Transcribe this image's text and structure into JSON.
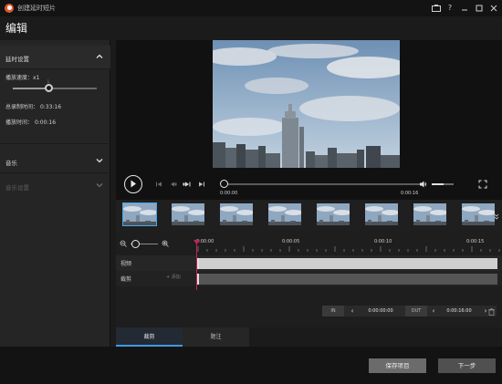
{
  "window": {
    "title": "创建延时短片",
    "controls": [
      "device-icon",
      "help-icon",
      "minimize-icon",
      "maximize-icon",
      "close-icon"
    ]
  },
  "header": {
    "title": "编辑"
  },
  "sidebar": {
    "section_timelapse": {
      "label": "延时设置",
      "expanded": true,
      "speed_label": "播放速度：",
      "speed_value": "x1",
      "speed_slider": {
        "level": 0.42,
        "tick_label": "1"
      },
      "total_record_label": "总录制时间：",
      "total_record_value": "0:33:16",
      "play_time_label": "播放时间：",
      "play_time_value": "0:00:16"
    },
    "section_music": {
      "label": "音乐",
      "expanded": false
    },
    "section_music_settings": {
      "label": "音乐设置",
      "expanded": false,
      "disabled": true
    }
  },
  "player": {
    "current_time": "0:00:00",
    "end_time": "0:00:16",
    "progress": 0,
    "volume": 0.55,
    "controls": [
      "play-icon",
      "skip-start-icon",
      "prev-frame-icon",
      "next-frame-icon",
      "skip-end-icon",
      "volume-icon",
      "fullscreen-icon"
    ]
  },
  "thumbnails": {
    "count": 8,
    "selected_index": 0
  },
  "timeline": {
    "ruler_labels": [
      "0:00:00",
      "0:00:05",
      "0:00:10",
      "0:00:15"
    ],
    "tracks": [
      {
        "label": "视频"
      },
      {
        "label": "裁剪",
        "add_label": "+ 添加"
      }
    ],
    "in_label": "IN",
    "in_value": "0:00:00:00",
    "out_label": "OUT",
    "out_value": "0:00:16:00"
  },
  "tabs": [
    {
      "label": "裁剪",
      "active": true
    },
    {
      "label": "题注",
      "active": false
    }
  ],
  "footer": {
    "save_label": "保存项目",
    "next_label": "下一步"
  },
  "colors": {
    "accent": "#3d9ae6",
    "playhead": "#c0245e",
    "background": "#1b1b1b"
  }
}
